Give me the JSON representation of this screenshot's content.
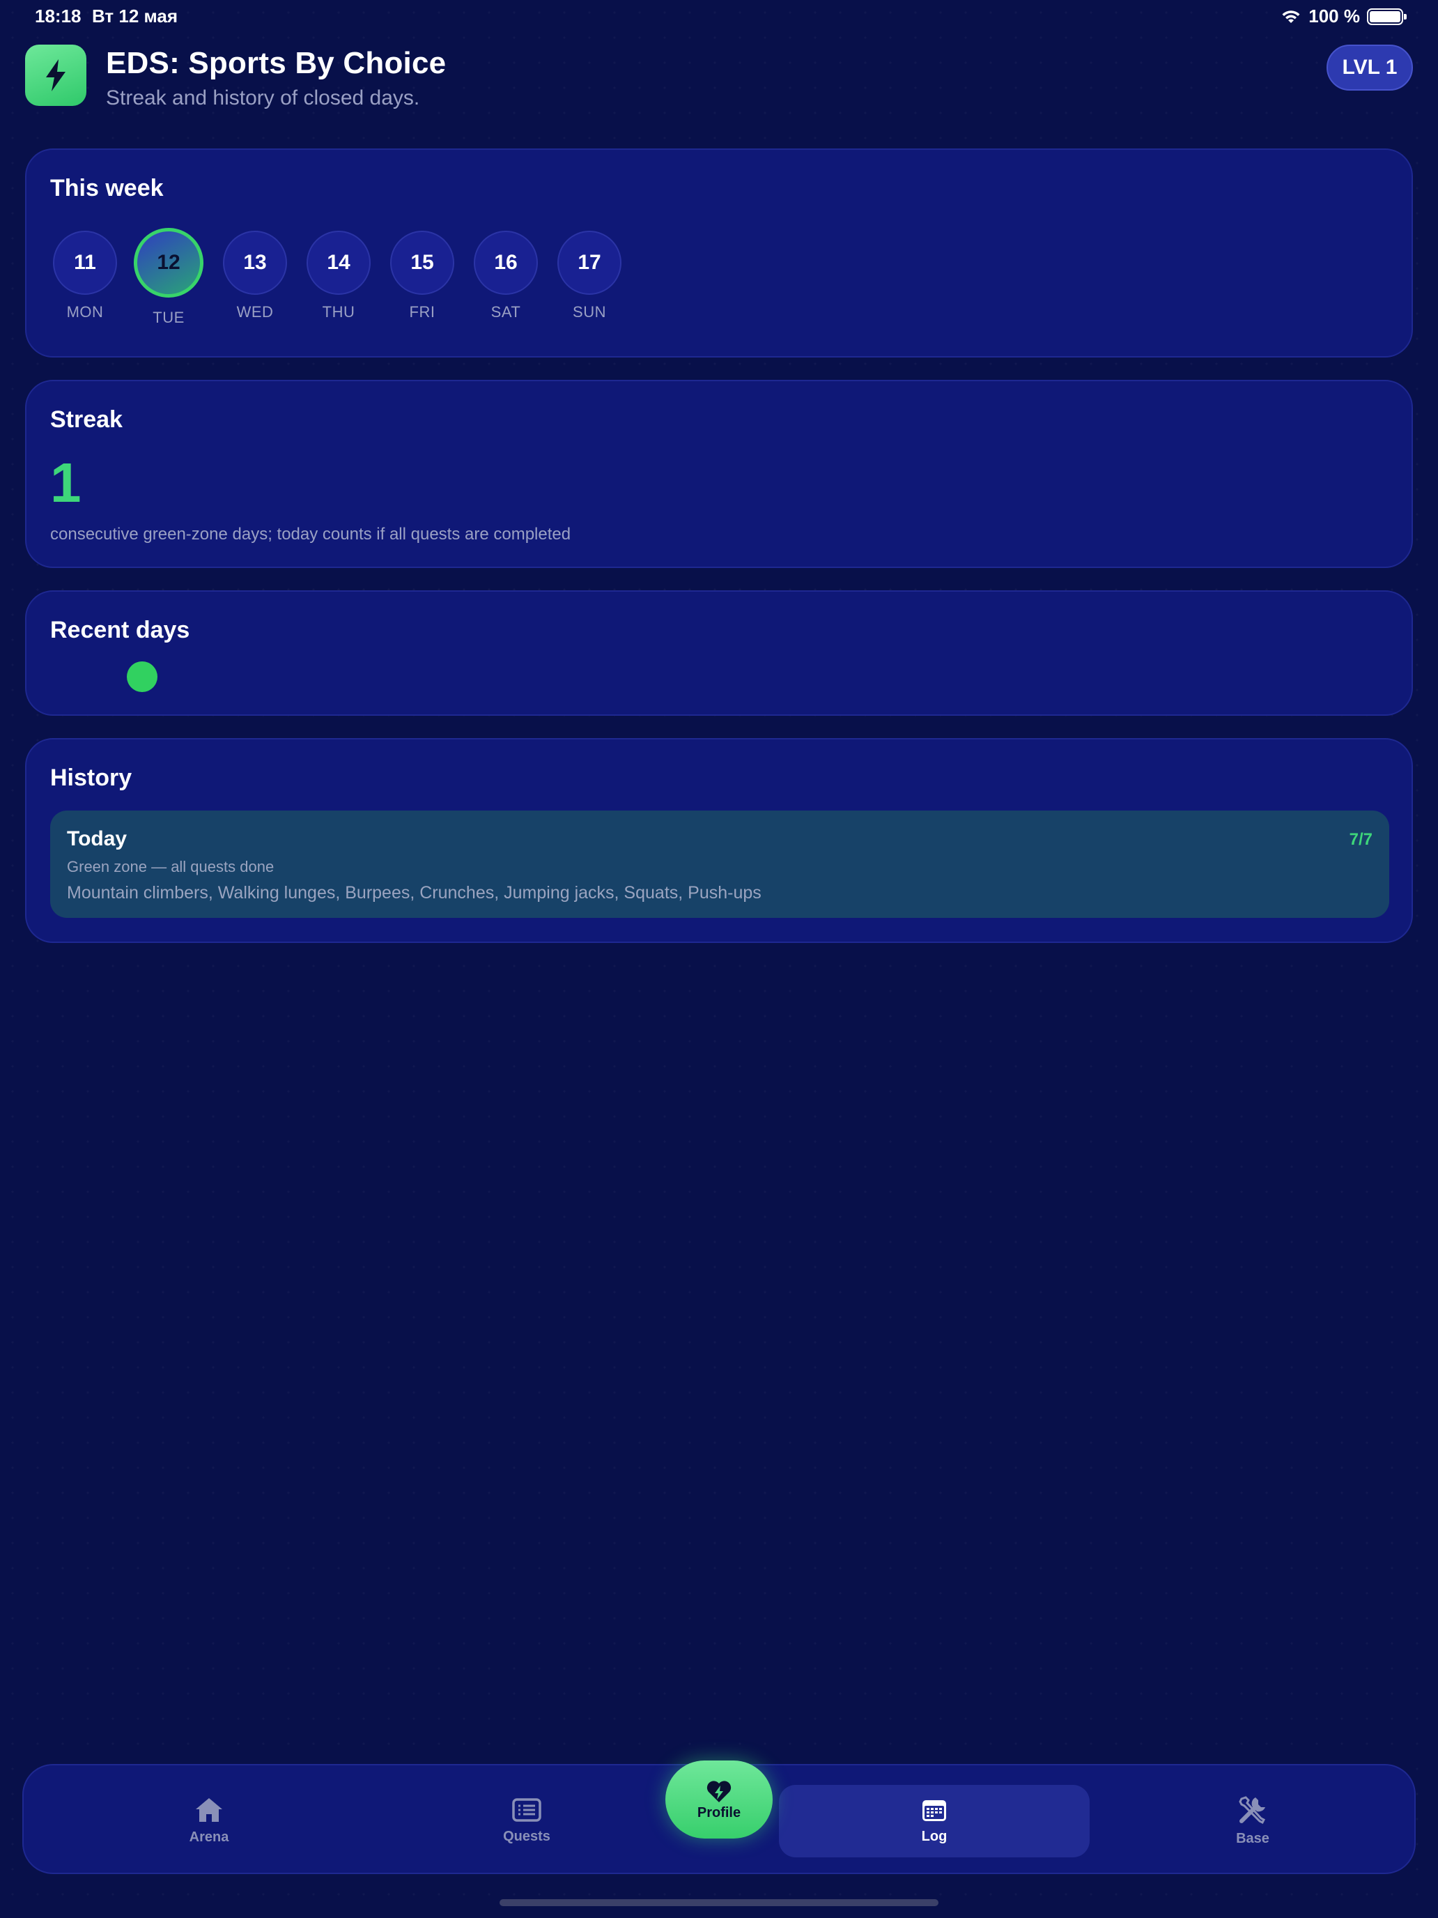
{
  "status_bar": {
    "time": "18:18",
    "date": "Вт 12 мая",
    "battery": "100 %"
  },
  "header": {
    "title": "EDS: Sports By Choice",
    "subtitle": "Streak and history of closed days.",
    "level_badge": "LVL 1"
  },
  "week": {
    "title": "This week",
    "days": [
      {
        "num": "11",
        "label": "MON"
      },
      {
        "num": "12",
        "label": "TUE",
        "selected": true
      },
      {
        "num": "13",
        "label": "WED"
      },
      {
        "num": "14",
        "label": "THU"
      },
      {
        "num": "15",
        "label": "FRI"
      },
      {
        "num": "16",
        "label": "SAT"
      },
      {
        "num": "17",
        "label": "SUN"
      }
    ]
  },
  "streak": {
    "title": "Streak",
    "value": "1",
    "description": "consecutive green-zone days; today counts if all quests are completed"
  },
  "recent": {
    "title": "Recent days",
    "days": [
      {
        "status": "green"
      }
    ]
  },
  "history": {
    "title": "History",
    "items": [
      {
        "title": "Today",
        "count": "7/7",
        "zone": "Green zone — all quests done",
        "exercises": "Mountain climbers, Walking lunges, Burpees, Crunches, Jumping jacks, Squats, Push-ups"
      }
    ]
  },
  "tabbar": {
    "arena": "Arena",
    "quests": "Quests",
    "profile": "Profile",
    "log": "Log",
    "base": "Base",
    "selected": "Log"
  },
  "colors": {
    "background": "#08104a",
    "card": "#0f1877",
    "accent_green": "#3ed67a",
    "history_item": "#174268"
  }
}
